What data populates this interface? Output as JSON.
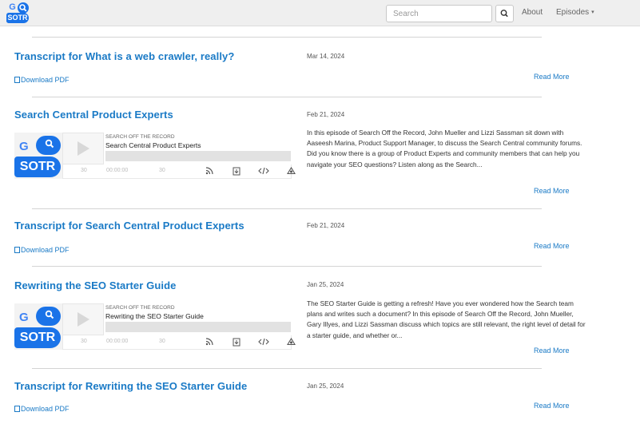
{
  "navbar": {
    "logo": {
      "g": "G",
      "text": "SOTR"
    },
    "search_placeholder": "Search",
    "about_label": "About",
    "episodes_label": "Episodes",
    "caret": "▾"
  },
  "entries": [
    {
      "title": "Transcript for What is a web crawler, really?",
      "date": "Mar 14, 2024",
      "download_label": "Download PDF",
      "read_more": "Read More"
    },
    {
      "title": "Search Central Product Experts",
      "date": "Feb 21, 2024",
      "description": "In this episode of Search Off the Record, John Mueller and Lizzi Sassman sit down with Aaseesh Marina, Product Support Manager, to discuss the Search Central community forums. Did you know there is a group of Product Experts and community members that can help you navigate your SEO questions? Listen along as the Search...",
      "read_more": "Read More",
      "player": {
        "kicker": "Search Off The Record",
        "title": "Search Central Product Experts",
        "rewind": "30",
        "time": "00:00:00",
        "forward": "30",
        "logo_g": "G",
        "logo_text": "SOTR"
      }
    },
    {
      "title": "Transcript for Search Central Product Experts",
      "date": "Feb 21, 2024",
      "download_label": "Download PDF",
      "read_more": "Read More"
    },
    {
      "title": "Rewriting the SEO Starter Guide",
      "date": "Jan 25, 2024",
      "description": "The SEO Starter Guide is getting a refresh! Have you ever wondered how the Search team plans and writes such a document? In this episode of Search Off the Record, John Mueller, Gary Illyes, and Lizzi Sassman discuss which topics are still relevant, the right level of detail for a starter guide, and whether or...",
      "read_more": "Read More",
      "player": {
        "kicker": "Search Off The Record",
        "title": "Rewriting the SEO Starter Guide",
        "rewind": "30",
        "time": "00:00:00",
        "forward": "30",
        "logo_g": "G",
        "logo_text": "SOTR"
      }
    },
    {
      "title": "Transcript for Rewriting the SEO Starter Guide",
      "date": "Jan 25, 2024",
      "download_label": "Download PDF",
      "read_more": "Read More"
    }
  ],
  "icons": {
    "search_button": "search-icon",
    "pdf": "document-icon",
    "play": "play-icon",
    "rss": "rss-icon",
    "download": "download-icon",
    "embed": "code-icon",
    "share": "share-icon"
  },
  "colors": {
    "link": "#1a7ac6",
    "brand": "#1a73e8",
    "navbar_bg": "#efefef"
  }
}
